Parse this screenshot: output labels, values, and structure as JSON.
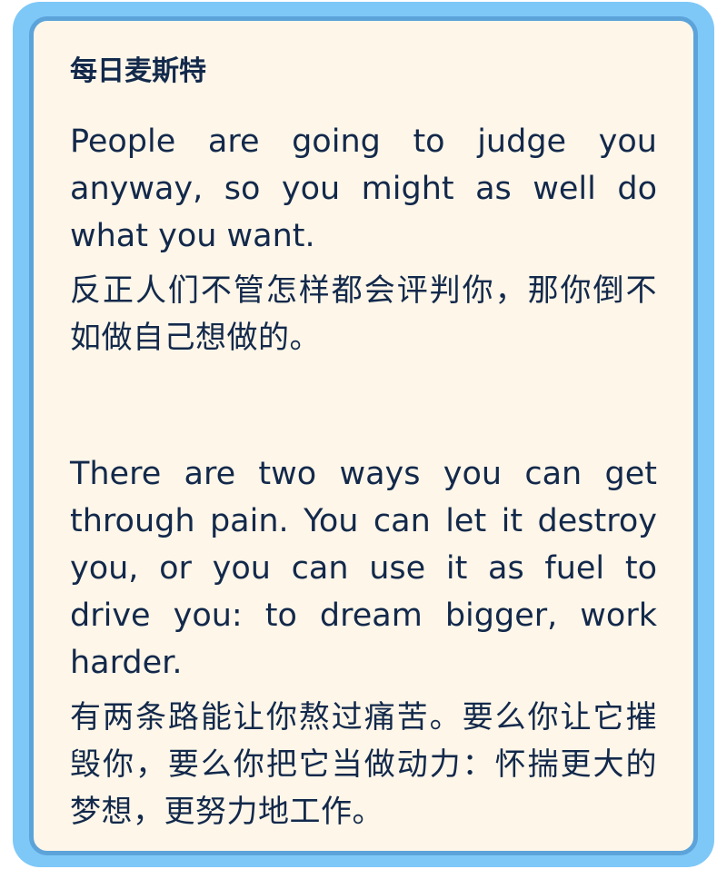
{
  "card": {
    "title": "每日麦斯特",
    "quotes": [
      {
        "en": "People are going to judge you anyway, so you might as well do what you want.",
        "zh": "反正人们不管怎样都会评判你，那你倒不如做自己想做的。"
      },
      {
        "en": "There are two ways you can get through pain. You can let it destroy you, or you can use it as fuel to drive you: to dream bigger, work harder.",
        "zh": "有两条路能让你熬过痛苦。要么你让它摧毁你，要么你把它当做动力：怀揣更大的梦想，更努力地工作。"
      }
    ]
  },
  "colors": {
    "outer_border": "#7ec8f8",
    "inner_border": "#5ca3da",
    "background": "#fdf6e9",
    "text": "#13294b"
  }
}
